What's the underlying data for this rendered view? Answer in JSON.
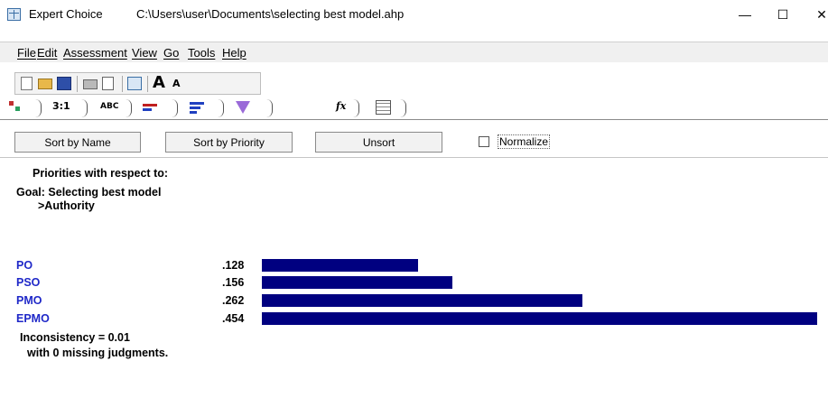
{
  "window": {
    "app_name": "Expert Choice",
    "file_path": "C:\\Users\\user\\Documents\\selecting best model.ahp",
    "minimize_glyph": "—",
    "maximize_glyph": "☐",
    "close_glyph": "✕"
  },
  "menu": [
    {
      "label": "File"
    },
    {
      "label": "Edit"
    },
    {
      "label": "Assessment"
    },
    {
      "label": "View"
    },
    {
      "label": "Go"
    },
    {
      "label": "Tools"
    },
    {
      "label": "Help"
    }
  ],
  "toolbar": {
    "icons": [
      "new-file-icon",
      "open-folder-icon",
      "save-icon",
      "print-icon",
      "print-preview-icon",
      "model-view-icon",
      "font-increase-icon",
      "font-decrease-icon"
    ],
    "font_up_glyph": "A",
    "font_down_glyph": "A"
  },
  "tabs": [
    {
      "icon": "tree-icon",
      "label": ""
    },
    {
      "icon": "",
      "label": "3:1"
    },
    {
      "icon": "",
      "label": "ABC"
    },
    {
      "icon": "bar-chart-icon",
      "label": ""
    },
    {
      "icon": "priorities-icon",
      "label": ""
    },
    {
      "icon": "funnel-icon",
      "label": ""
    },
    {
      "icon": "formula-icon",
      "label": "fx"
    },
    {
      "icon": "grid-icon",
      "label": ""
    }
  ],
  "sort_buttons": {
    "by_name": "Sort by Name",
    "by_priority": "Sort by Priority",
    "unsort": "Unsort"
  },
  "normalize": {
    "label": "Normalize",
    "checked": false
  },
  "priorities": {
    "header": "Priorities with respect to:",
    "goal": "Goal: Selecting best model",
    "node": ">Authority",
    "bar_color": "#000080",
    "name_color": "#1f28c8",
    "alternatives": [
      {
        "name": "PO",
        "value": ".128",
        "priority": 0.128
      },
      {
        "name": "PSO",
        "value": ".156",
        "priority": 0.156
      },
      {
        "name": "PMO",
        "value": ".262",
        "priority": 0.262
      },
      {
        "name": "EPMO",
        "value": ".454",
        "priority": 0.454
      }
    ],
    "inconsistency": "Inconsistency = 0.01",
    "missing": "with 0  missing judgments."
  }
}
